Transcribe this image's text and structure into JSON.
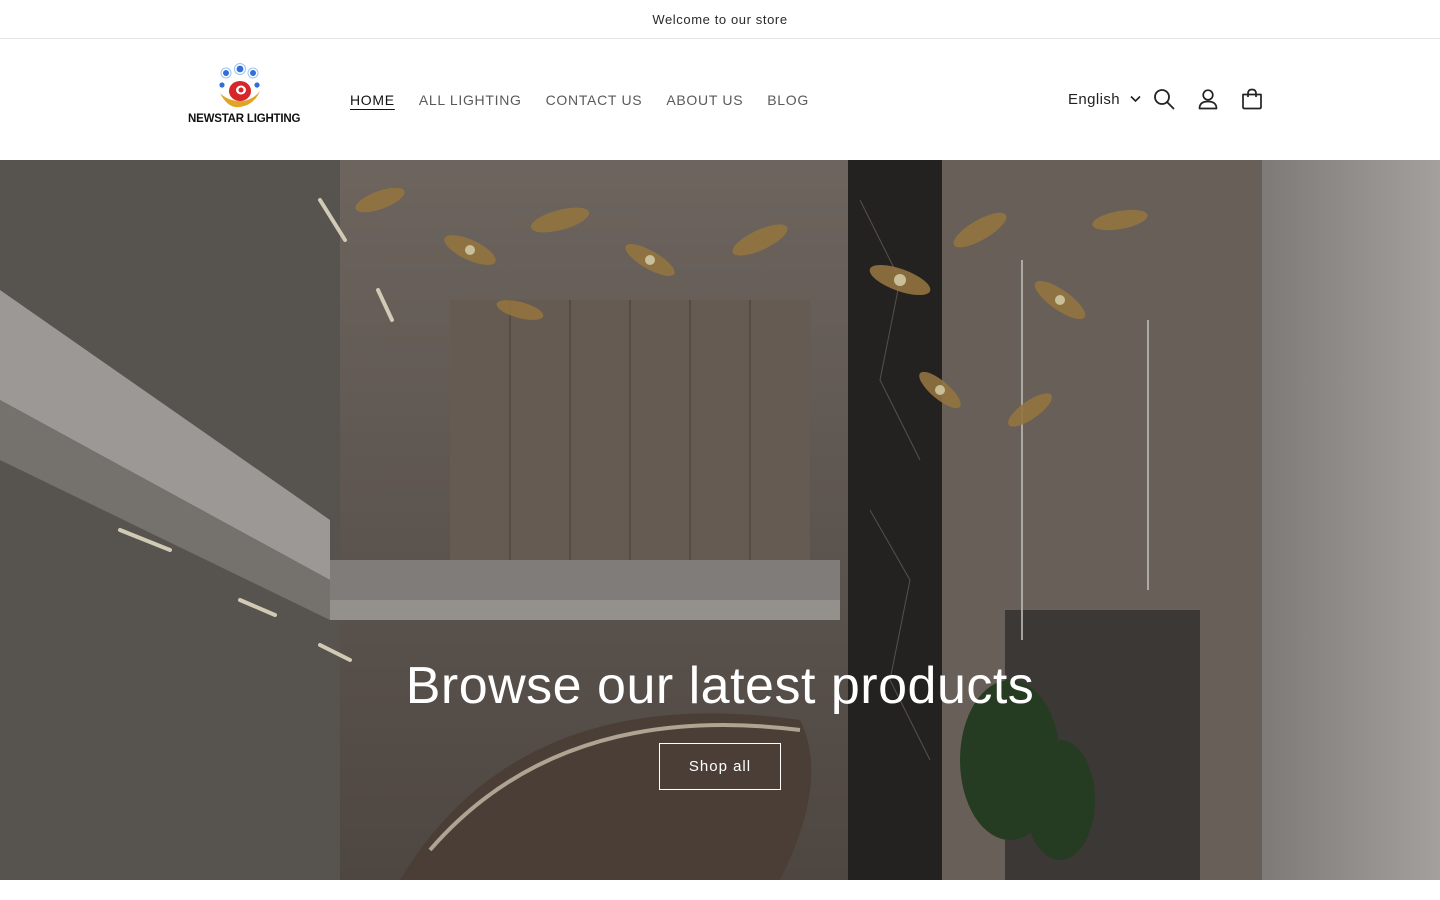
{
  "announcement": {
    "text": "Welcome to our store"
  },
  "header": {
    "logo_text": "NEWSTAR LIGHTING",
    "nav": [
      {
        "label": "HOME",
        "active": true
      },
      {
        "label": "ALL LIGHTING",
        "active": false
      },
      {
        "label": "CONTACT US",
        "active": false
      },
      {
        "label": "ABOUT US",
        "active": false
      },
      {
        "label": "BLOG",
        "active": false
      }
    ],
    "language": "English",
    "icons": [
      "search-icon",
      "account-icon",
      "cart-icon"
    ]
  },
  "hero": {
    "title": "Browse our latest products",
    "button_label": "Shop all"
  },
  "colors": {
    "text": "#121212",
    "nav_text": "#5a5a5a",
    "logo_red": "#d7262a",
    "logo_gold": "#e0a526",
    "logo_blue": "#2f6fd8"
  }
}
